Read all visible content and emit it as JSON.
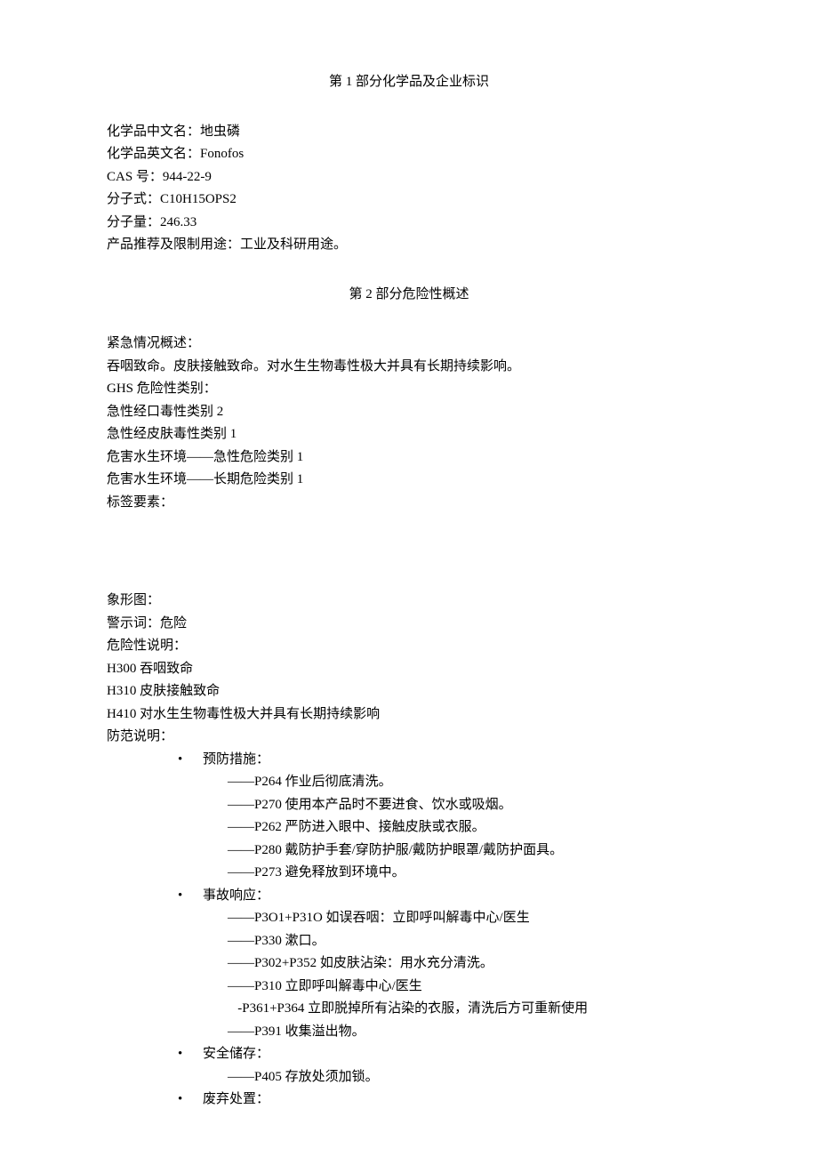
{
  "section1": {
    "title": "第 1 部分化学品及企业标识",
    "lines": [
      "化学品中文名：地虫磷",
      "化学品英文名：Fonofos",
      "CAS 号：944-22-9",
      "分子式：C10H15OPS2",
      "分子量：246.33",
      "产品推荐及限制用途：工业及科研用途。"
    ]
  },
  "section2": {
    "title": "第 2 部分危险性概述",
    "block1": [
      "紧急情况概述：",
      "吞咽致命。皮肤接触致命。对水生生物毒性极大并具有长期持续影响。",
      "GHS 危险性类别：",
      "急性经口毒性类别 2",
      "急性经皮肤毒性类别 1",
      "危害水生环境——急性危险类别 1",
      "危害水生环境——长期危险类别 1",
      "标签要素："
    ],
    "block2": [
      "象形图：",
      "警示词：危险",
      "危险性说明：",
      "H300 吞咽致命",
      "H310 皮肤接触致命",
      "H410 对水生生物毒性极大并具有长期持续影响",
      "防范说明："
    ],
    "bullets": [
      {
        "label": "预防措施：",
        "items": [
          "——P264 作业后彻底清洗。",
          "——P270 使用本产品时不要进食、饮水或吸烟。",
          "——P262 严防进入眼中、接触皮肤或衣服。",
          "——P280 戴防护手套/穿防护服/戴防护眼罩/戴防护面具。",
          "——P273 避免释放到环境中。"
        ]
      },
      {
        "label": "事故响应：",
        "items": [
          "——P3O1+P31O 如误吞咽：立即呼叫解毒中心/医生",
          "——P330 漱口。",
          "——P302+P352 如皮肤沾染：用水充分清洗。",
          "——P310 立即呼叫解毒中心/医生",
          "   -P361+P364 立即脱掉所有沾染的衣服，清洗后方可重新使用",
          "——P391 收集溢出物。"
        ]
      },
      {
        "label": "安全储存：",
        "items": [
          "——P405 存放处须加锁。"
        ]
      },
      {
        "label": "废弃处置：",
        "items": []
      }
    ]
  }
}
